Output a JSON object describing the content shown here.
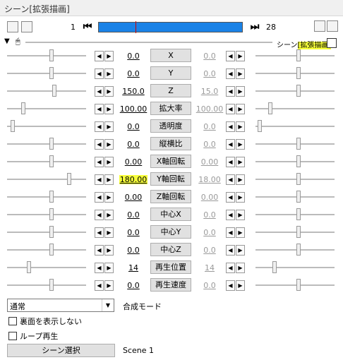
{
  "window": {
    "title": "シーン[拡張描画]"
  },
  "toolbar": {
    "frame_start": "1",
    "frame_end": "28",
    "scene_label_prefix": "シーン",
    "scene_label_highlight": "[拡張描画]"
  },
  "params": [
    {
      "name": "X",
      "left": "0.0",
      "right": "0.0",
      "lt": 70,
      "rt": 420
    },
    {
      "name": "Y",
      "left": "0.0",
      "right": "0.0",
      "lt": 70,
      "rt": 420
    },
    {
      "name": "Z",
      "left": "150.0",
      "right": "15.0",
      "lt": 74,
      "rt": 420
    },
    {
      "name": "拡大率",
      "left": "100.00",
      "right": "100.00",
      "lt": 30,
      "rt": 380
    },
    {
      "name": "透明度",
      "left": "0.0",
      "right": "0.0",
      "lt": 15,
      "rt": 365
    },
    {
      "name": "縦横比",
      "left": "0.0",
      "right": "0.0",
      "lt": 70,
      "rt": 420
    },
    {
      "name": "X軸回転",
      "left": "0.00",
      "right": "0.00",
      "lt": 70,
      "rt": 420
    },
    {
      "name": "Y軸回転",
      "left": "180.00",
      "right": "18.00",
      "lt": 95,
      "rt": 420,
      "highlight": true
    },
    {
      "name": "Z軸回転",
      "left": "0.00",
      "right": "0.00",
      "lt": 70,
      "rt": 420
    },
    {
      "name": "中心X",
      "left": "0.0",
      "right": "0.0",
      "lt": 70,
      "rt": 420
    },
    {
      "name": "中心Y",
      "left": "0.0",
      "right": "0.0",
      "lt": 70,
      "rt": 420
    },
    {
      "name": "中心Z",
      "left": "0.0",
      "right": "0.0",
      "lt": 70,
      "rt": 420
    },
    {
      "name": "再生位置",
      "left": "14",
      "right": "14",
      "lt": 38,
      "rt": 386
    },
    {
      "name": "再生速度",
      "left": "0.0",
      "right": "0.0",
      "lt": 70,
      "rt": 420
    }
  ],
  "blend": {
    "value": "通常",
    "label": "合成モード"
  },
  "options": {
    "hide_back": "裏面を表示しない",
    "loop": "ループ再生"
  },
  "scene": {
    "button": "シーン選択",
    "value": "Scene 1"
  }
}
